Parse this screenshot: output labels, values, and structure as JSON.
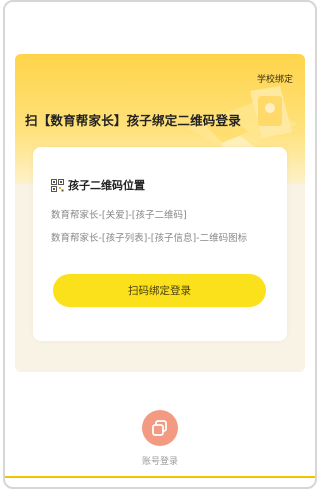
{
  "header": {
    "bind_link": "学校绑定"
  },
  "banner": {
    "title": "扫【数育帮家长】孩子绑定二维码登录"
  },
  "card": {
    "heading": "孩子二维码位置",
    "paths": [
      "数育帮家长-[关爱]-[孩子二维码]",
      "数育帮家长-[孩子列表]-[孩子信息]-二维码图标"
    ],
    "primary_button": "扫码绑定登录"
  },
  "footer": {
    "account_login_label": "账号登录",
    "account_icon": "copy-icon"
  },
  "colors": {
    "accent_yellow": "#fbe11b",
    "banner_yellow": "#ffd44a",
    "account_button": "#f29a82"
  }
}
